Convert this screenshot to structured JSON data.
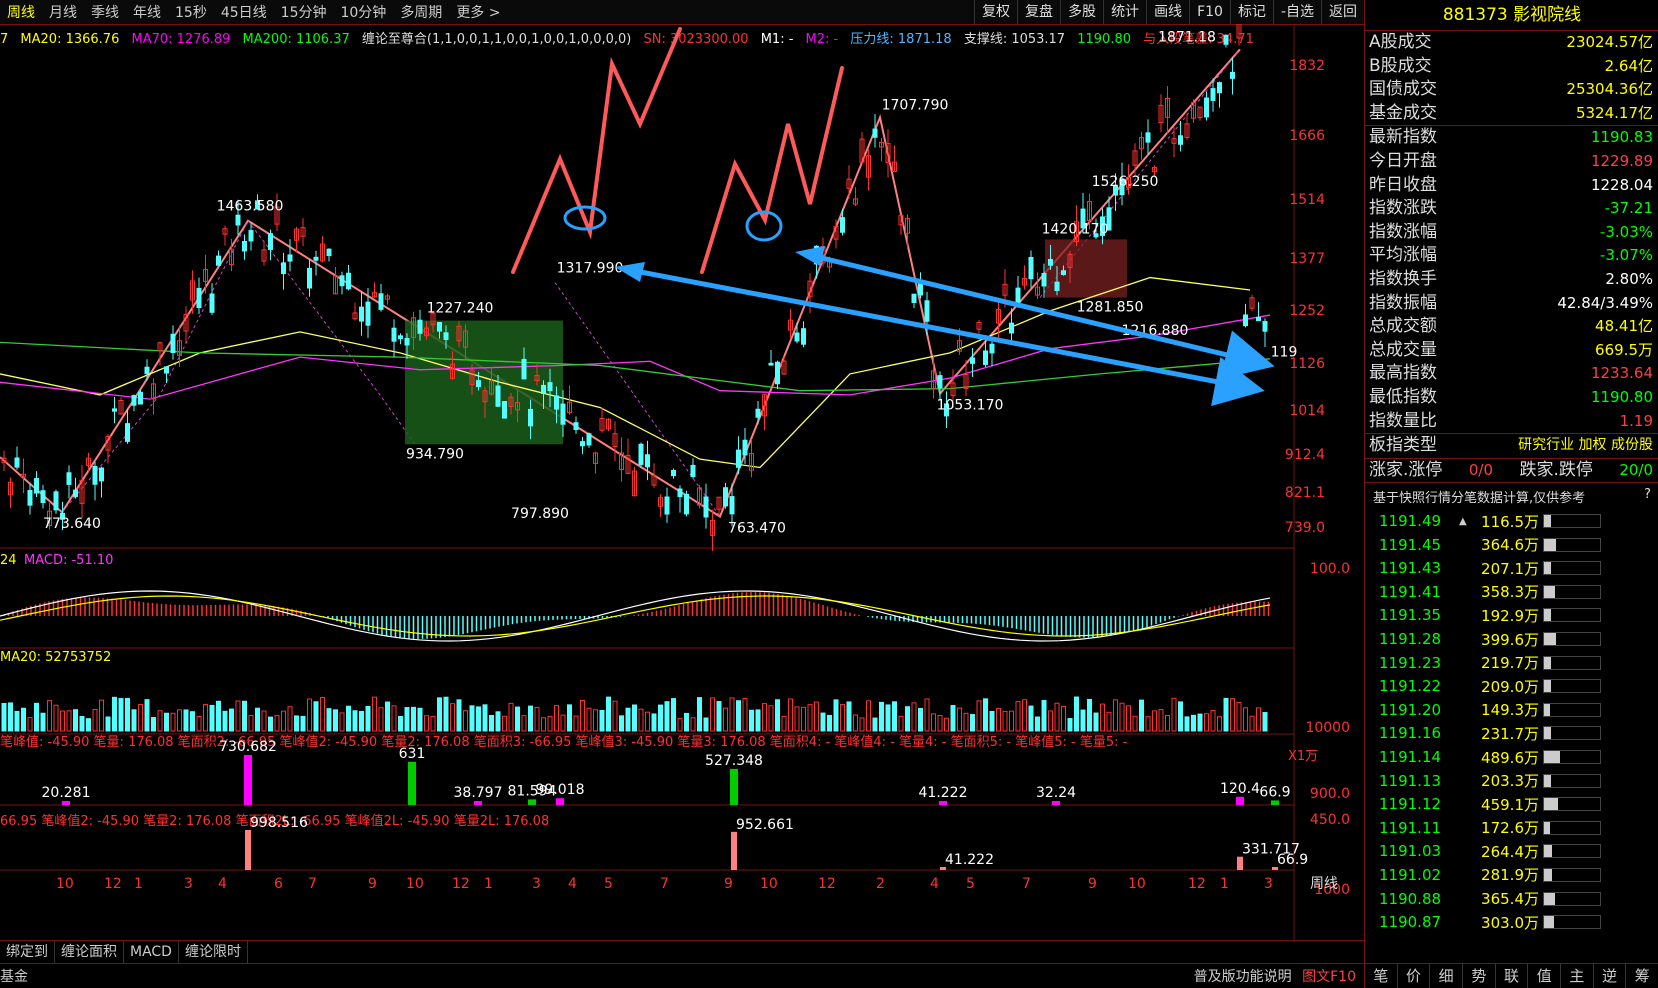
{
  "toolbar": {
    "periods": [
      "周线",
      "月线",
      "季线",
      "年线",
      "15秒",
      "45日线",
      "15分钟",
      "10分钟",
      "多周期",
      "更多 >"
    ],
    "tools": [
      "复权",
      "复盘",
      "多股",
      "统计",
      "画线",
      "F10",
      "标记",
      "-自选",
      "返回"
    ]
  },
  "legend": {
    "ma20": "MA20: 1366.76",
    "ma70": "MA70: 1276.89",
    "ma200": "MA200: 1106.37",
    "chan": "缠论至尊合(1,1,0,0,1,1,0,0,1,0,0,1,0,0,0,0)",
    "sn": "SN: 3023300.00",
    "m1": "M1: -",
    "m2": "M2: -",
    "pressure": "压力线: 1871.18",
    "support": "支撑线: 1053.17",
    "val": "1190.80",
    "diff": "与入段笔差: 34.71"
  },
  "price_axis": [
    "1832",
    "1666",
    "1514",
    "1377",
    "1252",
    "1126",
    "1014",
    "912.4",
    "821.1",
    "739.0"
  ],
  "peak_labels": [
    "1463.580",
    "1227.240",
    "1317.990",
    "934.790",
    "797.890",
    "773.640",
    "763.470",
    "1707.790",
    "1053.170",
    "1871.18",
    "1526.250",
    "1420.170",
    "1281.850",
    "1216.880",
    "119"
  ],
  "macd": {
    "label": "MACD: -51.10",
    "axis": "100.0",
    "prefix": "24"
  },
  "vol": {
    "label": "MA20: 52753752",
    "axis": "10000",
    "unit": "X1万"
  },
  "bi1": {
    "label": "笔峰值: -45.90  笔量: 176.08  笔面积2: -66.95  笔峰值2: -45.90  笔量2: 176.08  笔面积3: -66.95  笔峰值3: -45.90  笔量3: 176.08  笔面积4: -  笔峰值4: -  笔量4: -  笔面积5: -  笔峰值5: -  笔量5: -",
    "values": [
      "730.682",
      "631",
      "20.281",
      "38.797",
      "81.594",
      "99.018",
      "527.348",
      "41.222",
      "32.24",
      "120.4",
      "66.9"
    ],
    "axis": [
      "900.0",
      "450.0"
    ]
  },
  "bi2": {
    "label": "66.95  笔峰值2: -45.90  笔量2: 176.08  笔面积2L: -66.95  笔峰值2L: -45.90  笔量2L: 176.08",
    "values": [
      "998.516",
      "952.661",
      "41.222",
      "331.717",
      "66.9"
    ],
    "axis": "1000"
  },
  "xaxis": [
    "10",
    "12",
    "1",
    "3",
    "4",
    "6",
    "7",
    "9",
    "10",
    "12",
    "1",
    "3",
    "4",
    "5",
    "7",
    "9",
    "10",
    "12",
    "2",
    "4",
    "5",
    "7",
    "9",
    "10",
    "12",
    "1",
    "3"
  ],
  "period_label": "周线",
  "sidebar": {
    "code": "881373",
    "name": "影视院线",
    "turnover": [
      {
        "k": "A股成交",
        "v": "23024.57亿"
      },
      {
        "k": "B股成交",
        "v": "2.64亿"
      },
      {
        "k": "国债成交",
        "v": "25304.36亿"
      },
      {
        "k": "基金成交",
        "v": "5324.17亿"
      }
    ],
    "stats": [
      {
        "k": "最新指数",
        "v": "1190.83",
        "c": "#00ff00"
      },
      {
        "k": "今日开盘",
        "v": "1229.89",
        "c": "#ff4040"
      },
      {
        "k": "昨日收盘",
        "v": "1228.04",
        "c": "#ffffff"
      },
      {
        "k": "指数涨跌",
        "v": "-37.21",
        "c": "#00ff00"
      },
      {
        "k": "指数涨幅",
        "v": "-3.03%",
        "c": "#00ff00"
      },
      {
        "k": "平均涨幅",
        "v": "-3.07%",
        "c": "#00ff00"
      },
      {
        "k": "指数换手",
        "v": "2.80%",
        "c": "#ffffff"
      },
      {
        "k": "指数振幅",
        "v": "42.84/3.49%",
        "c": "#ffffff"
      },
      {
        "k": "总成交额",
        "v": "48.41亿",
        "c": "#ffff00"
      },
      {
        "k": "总成交量",
        "v": "669.5万",
        "c": "#ffff00"
      },
      {
        "k": "最高指数",
        "v": "1233.64",
        "c": "#ff4040"
      },
      {
        "k": "最低指数",
        "v": "1190.80",
        "c": "#00ff00"
      },
      {
        "k": "指数量比",
        "v": "1.19",
        "c": "#ff4040"
      }
    ],
    "board_type_k": "板指类型",
    "board_type_v": "研究行业 加权 成份股",
    "updown_k": "涨家.涨停",
    "updown_v": "0/0",
    "down_k": "跌家.跌停",
    "down_v": "20/0",
    "note": "基于快照行情分笔数据计算,仅供参考",
    "note_q": "?",
    "ticks": [
      {
        "p": "1191.49",
        "a": "▲",
        "q": "116.5万",
        "r": 0.12
      },
      {
        "p": "1191.45",
        "a": "",
        "q": "364.6万",
        "r": 0.22
      },
      {
        "p": "1191.43",
        "a": "",
        "q": "207.1万",
        "r": 0.12
      },
      {
        "p": "1191.41",
        "a": "",
        "q": "358.3万",
        "r": 0.2
      },
      {
        "p": "1191.35",
        "a": "",
        "q": "192.9万",
        "r": 0.12
      },
      {
        "p": "1191.28",
        "a": "",
        "q": "399.6万",
        "r": 0.22
      },
      {
        "p": "1191.23",
        "a": "",
        "q": "219.7万",
        "r": 0.12
      },
      {
        "p": "1191.22",
        "a": "",
        "q": "209.0万",
        "r": 0.12
      },
      {
        "p": "1191.20",
        "a": "",
        "q": "149.3万",
        "r": 0.1
      },
      {
        "p": "1191.16",
        "a": "",
        "q": "231.7万",
        "r": 0.12
      },
      {
        "p": "1191.14",
        "a": "",
        "q": "489.6万",
        "r": 0.28
      },
      {
        "p": "1191.13",
        "a": "",
        "q": "203.3万",
        "r": 0.12
      },
      {
        "p": "1191.12",
        "a": "",
        "q": "459.1万",
        "r": 0.25
      },
      {
        "p": "1191.11",
        "a": "",
        "q": "172.6万",
        "r": 0.1
      },
      {
        "p": "1191.03",
        "a": "",
        "q": "264.4万",
        "r": 0.15
      },
      {
        "p": "1191.02",
        "a": "",
        "q": "281.9万",
        "r": 0.15
      },
      {
        "p": "1190.88",
        "a": "",
        "q": "365.4万",
        "r": 0.2
      },
      {
        "p": "1190.87",
        "a": "",
        "q": "303.0万",
        "r": 0.18
      }
    ],
    "tabs": [
      "笔",
      "价",
      "细",
      "势",
      "联",
      "值",
      "主",
      "逆",
      "筹"
    ]
  },
  "bottom": {
    "tabs": [
      "绑定到",
      "缠论面积",
      "MACD",
      "缠论限时"
    ],
    "left": "基金",
    "help": "普及版功能说明",
    "f10": "图文F10"
  }
}
